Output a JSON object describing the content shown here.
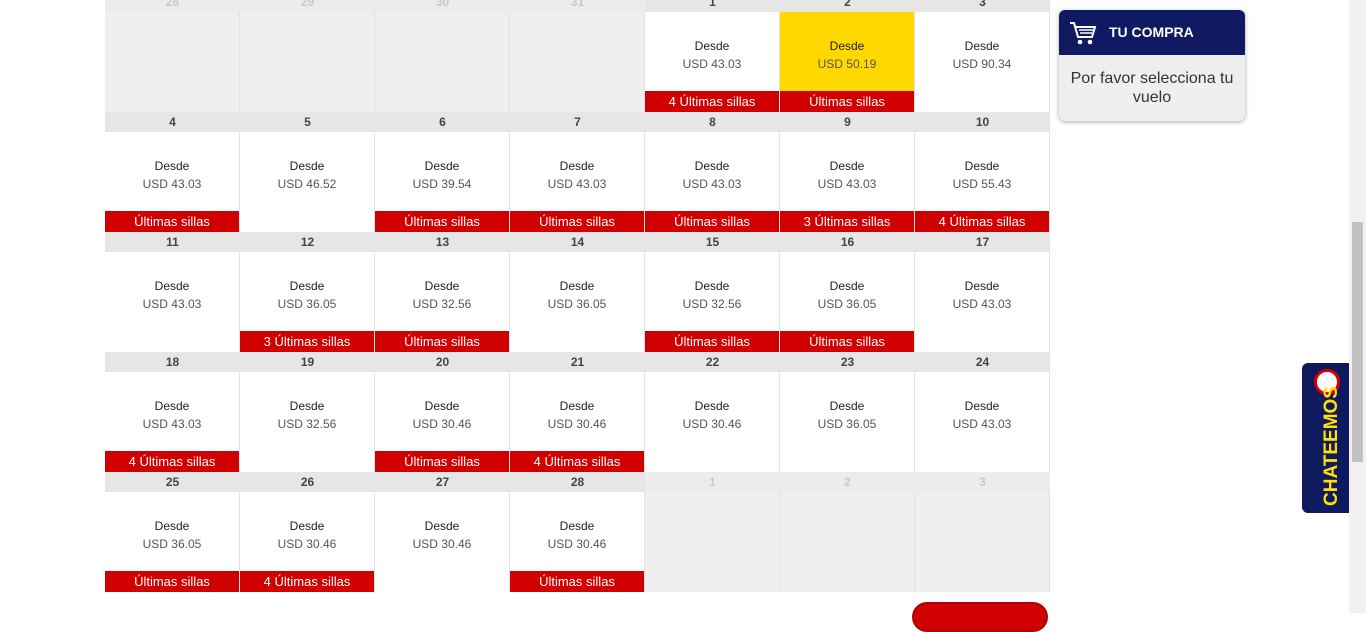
{
  "calendar": {
    "desde_label": "Desde",
    "weeks": [
      [
        {
          "day": "28",
          "out": true
        },
        {
          "day": "29",
          "out": true
        },
        {
          "day": "30",
          "out": true
        },
        {
          "day": "31",
          "out": true
        },
        {
          "day": "1",
          "price": "USD 43.03",
          "badge": "4 Últimas sillas"
        },
        {
          "day": "2",
          "price": "USD 50.19",
          "badge": "Últimas sillas",
          "selected": true
        },
        {
          "day": "3",
          "price": "USD 90.34"
        }
      ],
      [
        {
          "day": "4",
          "price": "USD 43.03",
          "badge": "Últimas sillas"
        },
        {
          "day": "5",
          "price": "USD 46.52"
        },
        {
          "day": "6",
          "price": "USD 39.54",
          "badge": "Últimas sillas"
        },
        {
          "day": "7",
          "price": "USD 43.03",
          "badge": "Últimas sillas"
        },
        {
          "day": "8",
          "price": "USD 43.03",
          "badge": "Últimas sillas"
        },
        {
          "day": "9",
          "price": "USD 43.03",
          "badge": "3 Últimas sillas"
        },
        {
          "day": "10",
          "price": "USD 55.43",
          "badge": "4 Últimas sillas"
        }
      ],
      [
        {
          "day": "11",
          "price": "USD 43.03"
        },
        {
          "day": "12",
          "price": "USD 36.05",
          "badge": "3 Últimas sillas"
        },
        {
          "day": "13",
          "price": "USD 32.56",
          "badge": "Últimas sillas"
        },
        {
          "day": "14",
          "price": "USD 36.05"
        },
        {
          "day": "15",
          "price": "USD 32.56",
          "badge": "Últimas sillas"
        },
        {
          "day": "16",
          "price": "USD 36.05",
          "badge": "Últimas sillas"
        },
        {
          "day": "17",
          "price": "USD 43.03"
        }
      ],
      [
        {
          "day": "18",
          "price": "USD 43.03",
          "badge": "4 Últimas sillas"
        },
        {
          "day": "19",
          "price": "USD 32.56"
        },
        {
          "day": "20",
          "price": "USD 30.46",
          "badge": "Últimas sillas"
        },
        {
          "day": "21",
          "price": "USD 30.46",
          "badge": "4 Últimas sillas"
        },
        {
          "day": "22",
          "price": "USD 30.46"
        },
        {
          "day": "23",
          "price": "USD 36.05"
        },
        {
          "day": "24",
          "price": "USD 43.03"
        }
      ],
      [
        {
          "day": "25",
          "price": "USD 36.05",
          "badge": "Últimas sillas"
        },
        {
          "day": "26",
          "price": "USD 30.46",
          "badge": "4 Últimas sillas"
        },
        {
          "day": "27",
          "price": "USD 30.46"
        },
        {
          "day": "28",
          "price": "USD 30.46",
          "badge": "Últimas sillas"
        },
        {
          "day": "1",
          "out": true
        },
        {
          "day": "2",
          "out": true
        },
        {
          "day": "3",
          "out": true
        }
      ]
    ]
  },
  "cart": {
    "title": "TU COMPRA",
    "message": "Por favor selecciona tu vuelo",
    "icon": "shopping-cart-icon"
  },
  "chat": {
    "label": "CHATEEMOS",
    "icon": "chat-bubble-icon"
  },
  "colors": {
    "navy": "#101a63",
    "badge_red": "#d10000",
    "selected_yellow": "#ffd800",
    "chat_text_yellow": "#ffe100"
  }
}
